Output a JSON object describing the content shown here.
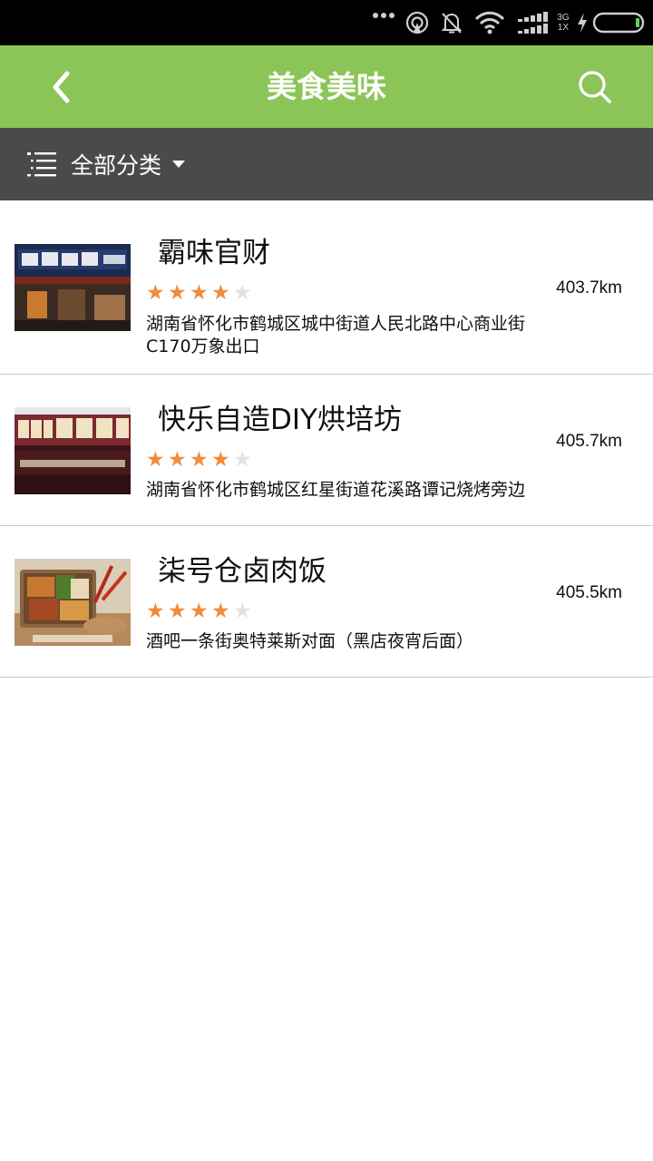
{
  "status_bar": {
    "icons": [
      "more-dots-icon",
      "hotspot-icon",
      "bell-off-icon",
      "wifi-icon",
      "signal-icon",
      "charging-bolt-icon",
      "battery-icon"
    ],
    "network_top": "3G",
    "network_bottom": "1X"
  },
  "header": {
    "title": "美食美味",
    "back_icon": "chevron-left-icon",
    "search_icon": "search-icon",
    "background": "#8cc557"
  },
  "filter": {
    "label": "全部分类",
    "icon": "list-icon",
    "background": "#4a4a4a"
  },
  "colors": {
    "star_on": "#f08c3c",
    "star_off": "#e2e2e2",
    "divider": "#c9c9c9"
  },
  "shops": [
    {
      "name": "霸味官财",
      "rating": 4,
      "max_rating": 5,
      "distance": "403.7km",
      "address": "湖南省怀化市鹤城区城中街道人民北路中心商业街C170万象出口"
    },
    {
      "name": "快乐自造DIY烘培坊",
      "rating": 4,
      "max_rating": 5,
      "distance": "405.7km",
      "address": "湖南省怀化市鹤城区红星街道花溪路谭记烧烤旁边"
    },
    {
      "name": "柒号仓卤肉饭",
      "rating": 4,
      "max_rating": 5,
      "distance": "405.5km",
      "address": "酒吧一条街奥特莱斯对面（黑店夜宵后面）"
    }
  ]
}
